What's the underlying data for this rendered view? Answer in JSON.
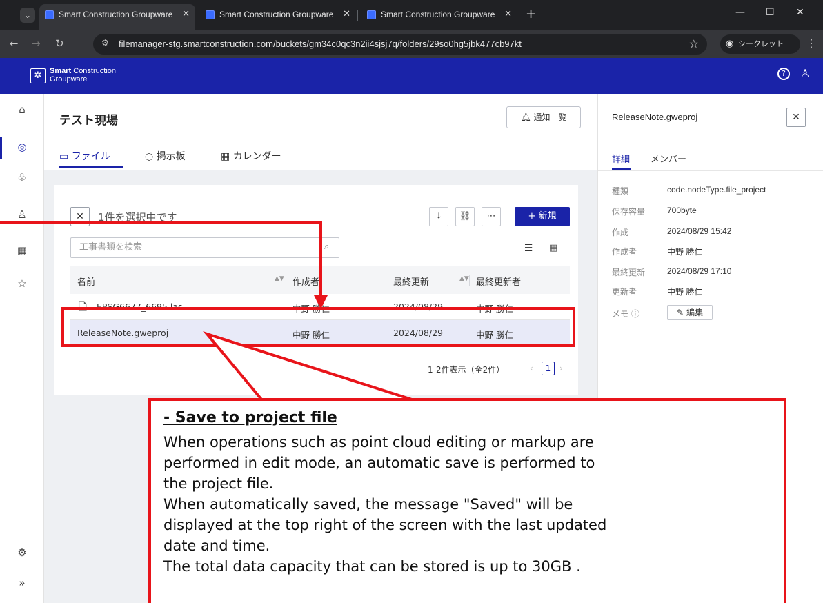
{
  "browser": {
    "tabs": [
      {
        "title": "Smart Construction Groupware",
        "active": true
      },
      {
        "title": "Smart Construction Groupware",
        "active": false
      },
      {
        "title": "Smart Construction Groupware",
        "active": false
      }
    ],
    "url": "filemanager-stg.smartconstruction.com/buckets/gm34c0qc3n2ii4sjsj7q/folders/29so0hg5jbk477cb97kt",
    "incognito_label": "シークレット"
  },
  "app": {
    "logo_line1_bold": "Smart",
    "logo_line1_rest": " Construction",
    "logo_line2": "Groupware",
    "help_icon": "question-circle-icon",
    "user_icon": "user-icon"
  },
  "sidebar": {
    "icons": [
      "home-icon",
      "location-icon",
      "people-icon",
      "user-icon",
      "calendar-icon",
      "star-icon"
    ],
    "bottom_icons": [
      "gear-icon",
      "expand-icon"
    ]
  },
  "main": {
    "title": "テスト現場",
    "notify_button": "通知一覧",
    "tabs": [
      {
        "label": "ファイル",
        "active": true
      },
      {
        "label": "掲示板",
        "active": false
      },
      {
        "label": "カレンダー",
        "active": false
      }
    ],
    "selection_text": "1件を選択中です",
    "new_button": "+ 新規",
    "search_placeholder": "工事書類を検索",
    "columns": [
      "名前",
      "作成者",
      "最終更新",
      "最終更新者"
    ],
    "rows": [
      {
        "name": "EPSG6677_6695.las",
        "creator": "中野 勝仁",
        "updated": "2024/08/29",
        "updater": "中野 勝仁",
        "selected": false
      },
      {
        "name": "ReleaseNote.gweproj",
        "creator": "中野 勝仁",
        "updated": "2024/08/29",
        "updater": "中野 勝仁",
        "selected": true
      }
    ],
    "pager_text": "1-2件表示（全2件）",
    "pager_page": "1"
  },
  "detail_panel": {
    "title": "ReleaseNote.gweproj",
    "tabs": [
      {
        "label": "詳細",
        "active": true
      },
      {
        "label": "メンバー",
        "active": false
      }
    ],
    "fields": [
      {
        "key": "種類",
        "value": "code.nodeType.file_project"
      },
      {
        "key": "保存容量",
        "value": "700byte"
      },
      {
        "key": "作成",
        "value": "2024/08/29 15:42"
      },
      {
        "key": "作成者",
        "value": "中野 勝仁"
      },
      {
        "key": "最終更新",
        "value": "2024/08/29 17:10"
      },
      {
        "key": "更新者",
        "value": "中野 勝仁"
      }
    ],
    "memo_label": "メモ ⓘ",
    "edit_button": "編集"
  },
  "annotation": {
    "title": "- Save to project file",
    "lines": [
      "When operations such as point cloud editing or markup are",
      "performed in edit mode, an automatic save is performed to",
      "the project file.",
      "When automatically saved, the message \"Saved\" will be",
      "displayed at the top right of the screen with the last updated",
      "date and time.",
      "The total data capacity that can be stored is up to 30GB ."
    ],
    "accent_color": "#e8141a"
  },
  "colors": {
    "brand": "#1a23a8",
    "selected_row": "#e8eaf8"
  }
}
